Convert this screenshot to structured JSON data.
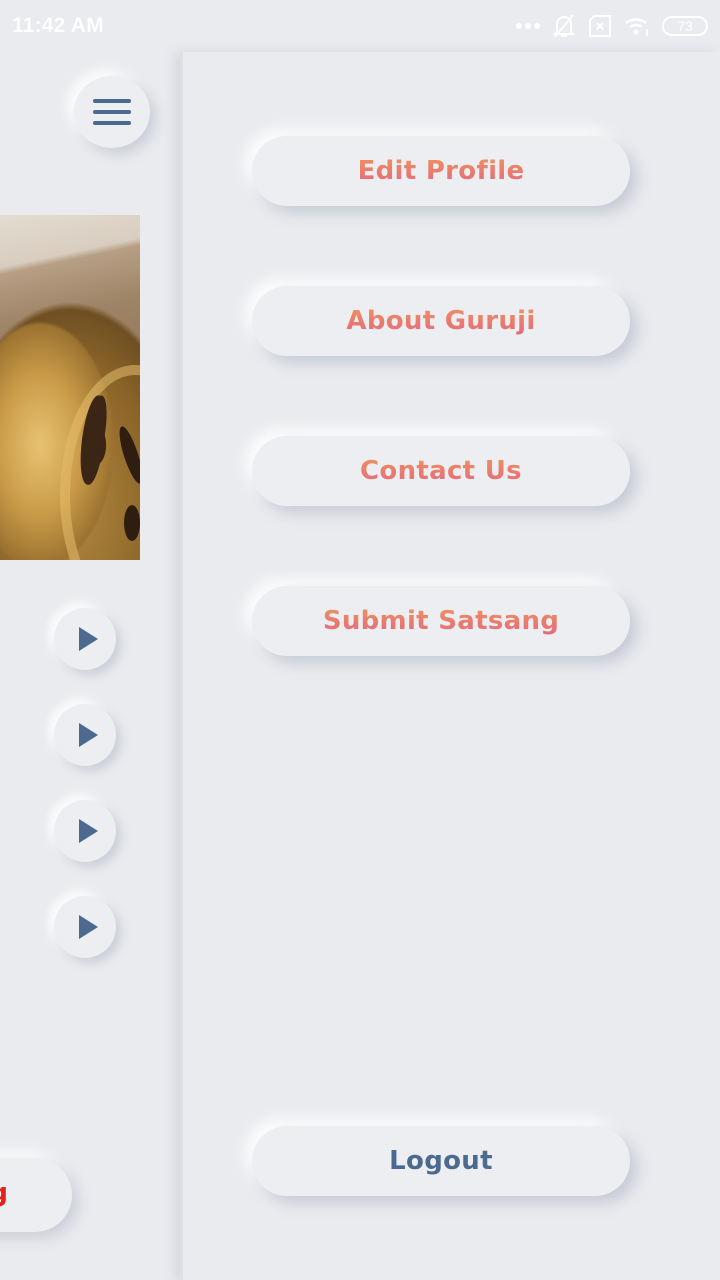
{
  "status_bar": {
    "time": "11:42 AM",
    "icons": [
      "more-dots-icon",
      "notifications-muted-icon",
      "sim-off-icon",
      "wifi-icon",
      "battery-icon"
    ],
    "battery_level": "73"
  },
  "main_screen": {
    "menu_icon": "hamburger-menu-icon",
    "hero_image_alt": "Golden statue",
    "play_buttons": [
      {
        "icon": "play-icon"
      },
      {
        "icon": "play-icon"
      },
      {
        "icon": "play-icon"
      },
      {
        "icon": "play-icon"
      }
    ],
    "bottom_button_partial_text": "g"
  },
  "drawer": {
    "items": [
      {
        "label": "Edit Profile"
      },
      {
        "label": "About Guruji"
      },
      {
        "label": "Contact Us"
      },
      {
        "label": "Submit Satsang"
      }
    ],
    "logout_label": "Logout"
  },
  "colors": {
    "background": "#eaebef",
    "accent_gradient_top": "#ef9460",
    "accent_gradient_bottom": "#e46a82",
    "icon_blue": "#4c6a8f",
    "partial_red": "#e0241b"
  }
}
